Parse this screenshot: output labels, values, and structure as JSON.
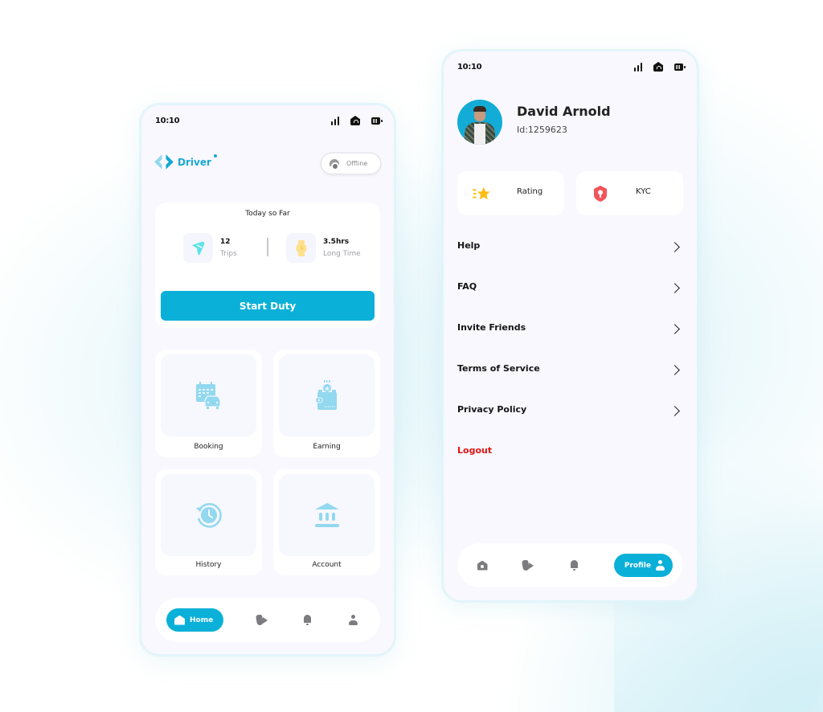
{
  "driver_home": {
    "status_bar": {
      "time": "10:10"
    },
    "brand": {
      "name": "Driver"
    },
    "status_toggle": {
      "label": "Offline"
    },
    "today_card": {
      "title": "Today so Far",
      "stats": [
        {
          "value": "12",
          "label": "Trips",
          "icon": "route-icon",
          "color": "#5ee3ea"
        },
        {
          "value": "3.5hrs",
          "label": "Long Time",
          "icon": "watch-icon",
          "color": "#fde08a"
        }
      ],
      "cta_label": "Start Duty"
    },
    "tiles": [
      {
        "label": "Booking",
        "icon": "calendar-car-icon"
      },
      {
        "label": "Earning",
        "icon": "wallet-icon"
      },
      {
        "label": "History",
        "icon": "history-icon"
      },
      {
        "label": "Account",
        "icon": "bank-icon"
      }
    ],
    "nav": {
      "active_label": "Home",
      "items": [
        "home-icon",
        "route-icon",
        "bell-icon",
        "person-icon"
      ]
    }
  },
  "profile": {
    "status_bar": {
      "time": "10:10"
    },
    "user": {
      "name": "David Arnold",
      "id": "Id:1259623"
    },
    "quick_actions": [
      {
        "label": "Rating",
        "icon": "star-icon",
        "color": "#fbbd13"
      },
      {
        "label": "KYC",
        "icon": "shield-lock-icon",
        "color": "#f2545b"
      }
    ],
    "menu": [
      {
        "label": "Help"
      },
      {
        "label": "FAQ"
      },
      {
        "label": "Invite Friends"
      },
      {
        "label": "Terms of Service"
      },
      {
        "label": "Privacy Policy"
      }
    ],
    "logout_label": "Logout",
    "nav": {
      "active_label": "Profile",
      "items": [
        "home-icon",
        "route-icon",
        "bell-icon",
        "person-icon"
      ]
    }
  },
  "colors": {
    "accent": "#0ab0d8",
    "icon_tint": "#8fd6ec",
    "danger": "#e01414",
    "nav_inactive": "#7c7c80"
  }
}
